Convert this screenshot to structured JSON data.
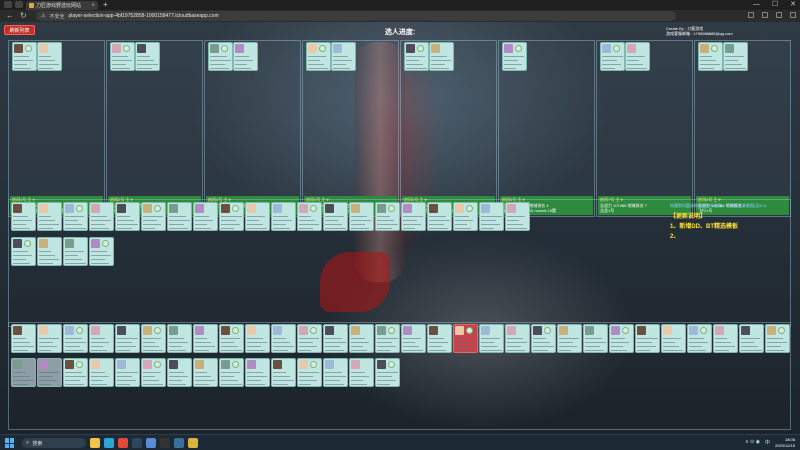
{
  "browser": {
    "tab_title": "刀匠游戏野选玩网站",
    "new_tab_icon": "plus-icon",
    "security_label": "不安全",
    "url": "player-selection-app-4bf19752858-1000158477.tcloudbaseapp.com",
    "window_controls": [
      "—",
      "☐",
      "✕"
    ]
  },
  "page": {
    "top_button": "刷新列表",
    "title": "选人进度:",
    "credits_line1": "Create By : 刀客游戏",
    "credits_line2": "游戏客服邮箱 : 1798988888@qq.com"
  },
  "rooms": [
    {
      "l1": "房间1号 主 ♥",
      "l2": "总战力 134438 地城排名 5",
      "l3": "武器1号 C 3分 5 rounds 10题"
    },
    {
      "l1": "房间2号 主 ♥",
      "l2": "总战力 108441 地城排名 5",
      "l3": "猛兽1号"
    },
    {
      "l1": "房间3号 主 ♥",
      "l2": "总战力 97715 地城排名 4",
      "l3": "武者1号"
    },
    {
      "l1": "房间4号 主 ♥",
      "l2": "总战力 145013 地城排名 3",
      "l3": "刺客1号 C 3分 10 rounds 20题"
    },
    {
      "l1": "房间5号 主 ♥",
      "l2": "总战力 147768 地城排名 6",
      "l3": "时间1号 C 1分 15 rounds 20题"
    },
    {
      "l1": "房间6号 主 ♥",
      "l2": "总战力 110513 地城排名 4",
      "l3": "秘术1号 C 3分 50 rounds 10题"
    },
    {
      "l1": "房间7号 主 ♥",
      "l2": "总战力 107466 地城排名 7",
      "l3": "法圣1号"
    },
    {
      "l1": "房间8号 主 ♥",
      "l2": "总战力 120286 地城排名 2",
      "l3": "飞行1号"
    }
  ],
  "announcement": {
    "header": "如遇到问题请带截图联系客服，与问题相关截图(见8-1)",
    "title": "【更新说明】",
    "items": [
      "1、新增DD、BT精选模板",
      "2、"
    ]
  },
  "taskbar": {
    "search_placeholder": "搜索",
    "time": "18:08",
    "date": "2025/12/16",
    "tray_lang": "中",
    "tray_text": "∧ ⊙ ◉"
  },
  "colors": {
    "card_bg": "#bfe6e0",
    "room_info_bg": "#2e8b3e",
    "accent_red": "#c0312b",
    "announce_yellow": "#ffe033"
  }
}
